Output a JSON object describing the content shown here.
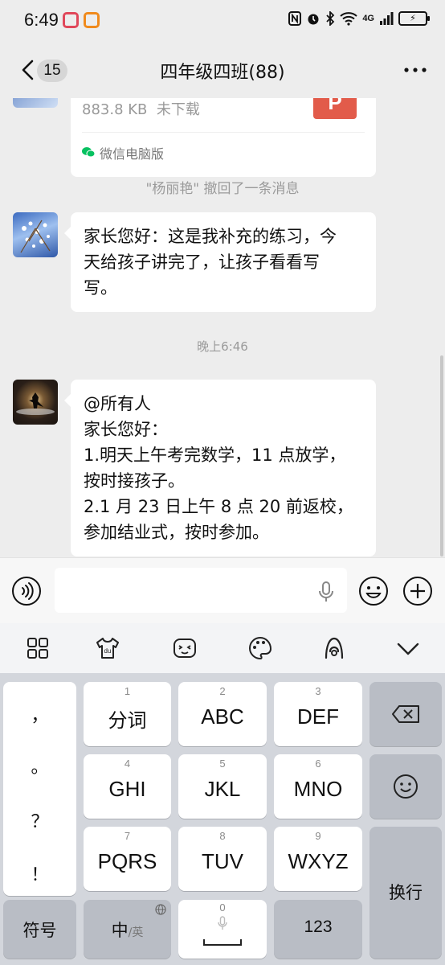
{
  "status_bar": {
    "time": "6:49",
    "network": "4G",
    "battery": "⚡"
  },
  "nav": {
    "unread_badge": "15",
    "title": "四年级四班(88)"
  },
  "chat": {
    "file_card": {
      "size": "883.8 KB",
      "status": "未下载",
      "file_type_letter": "P",
      "source": "微信电脑版"
    },
    "recall_notice": "\"杨丽艳\" 撤回了一条消息",
    "message_1": {
      "lines": [
        "家长您好：这是我补充的练习，今",
        "天给孩子讲完了，让孩子看看写",
        "写。"
      ]
    },
    "timestamp": "晚上6:46",
    "message_2": {
      "lines": [
        "@所有人",
        "家长您好：",
        "1.明天上午考完数学，11 点放学，",
        "按时接孩子。",
        "2.1 月 23 日上午 8 点 20 前返校，",
        "参加结业式，按时参加。"
      ]
    }
  },
  "input_bar": {
    "placeholder": ""
  },
  "keyboard": {
    "punctuation": [
      "，",
      "。",
      "？",
      "！"
    ],
    "keys": [
      {
        "num": "1",
        "label": "分词"
      },
      {
        "num": "2",
        "label": "ABC"
      },
      {
        "num": "3",
        "label": "DEF"
      },
      {
        "num": "4",
        "label": "GHI"
      },
      {
        "num": "5",
        "label": "JKL"
      },
      {
        "num": "6",
        "label": "MNO"
      },
      {
        "num": "7",
        "label": "PQRS"
      },
      {
        "num": "8",
        "label": "TUV"
      },
      {
        "num": "9",
        "label": "WXYZ"
      }
    ],
    "symbols": "符号",
    "cn_en": "中",
    "cn_en_sub": "/英",
    "space_num": "0",
    "num_key": "123",
    "enter": "换行"
  },
  "colors": {
    "background": "#ededed",
    "bubble": "#ffffff",
    "file_icon": "#e25b4a",
    "wechat_green": "#07c160"
  }
}
